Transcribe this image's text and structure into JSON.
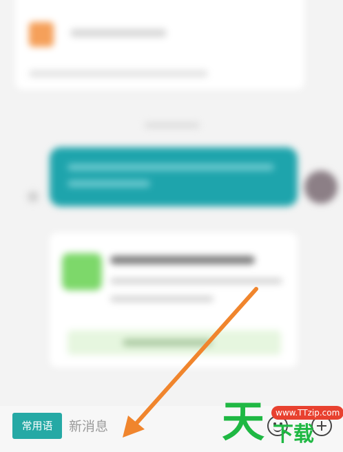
{
  "input_bar": {
    "common_phrases_label": "常用语",
    "message_placeholder": "新消息"
  },
  "icons": {
    "emoji": "smiley-icon",
    "add": "plus-circle-icon"
  },
  "annotation": {
    "arrow_color": "#f0852d"
  },
  "watermark": {
    "brand_char": "天",
    "url": "www.TTzip.com",
    "sub_text": "下载"
  },
  "colors": {
    "accent_teal": "#25a9a5",
    "bubble_teal": "#1ea4ac",
    "watermark_green": "#1fb843",
    "watermark_red": "#e8412f"
  }
}
